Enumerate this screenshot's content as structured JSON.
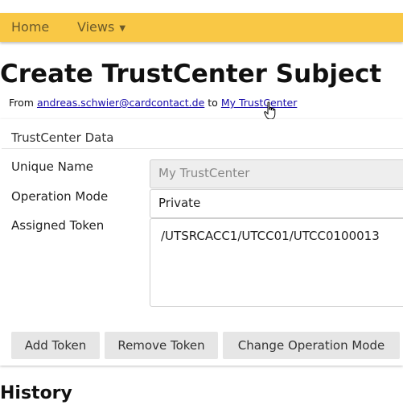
{
  "navbar": {
    "home_label": "Home",
    "views_label": "Views",
    "views_caret": "▼"
  },
  "page": {
    "title": "Create TrustCenter Subject",
    "from_prefix": "From",
    "from_user": "andreas.schwier@cardcontact.de",
    "to_word": "to",
    "to_target": "My TrustCenter"
  },
  "panel": {
    "heading": "TrustCenter Data",
    "fields": {
      "unique_name": {
        "label": "Unique Name",
        "value": "My TrustCenter"
      },
      "operation_mode": {
        "label": "Operation Mode",
        "value": "Private"
      },
      "assigned_token": {
        "label": "Assigned Token",
        "value": "/UTSRCACC1/UTCC01/UTCC0100013"
      }
    },
    "buttons": {
      "add_token": "Add Token",
      "remove_token": "Remove Token",
      "change_operation_mode": "Change Operation Mode"
    }
  },
  "history": {
    "title": "History"
  },
  "colors": {
    "navbar_bg": "#f9c845",
    "link": "#1a0dab",
    "button_bg": "#e6e6e6",
    "readonly_bg": "#eeeeee"
  },
  "icons": {
    "cursor": "hand-pointer-icon",
    "caret": "chevron-down-icon"
  }
}
